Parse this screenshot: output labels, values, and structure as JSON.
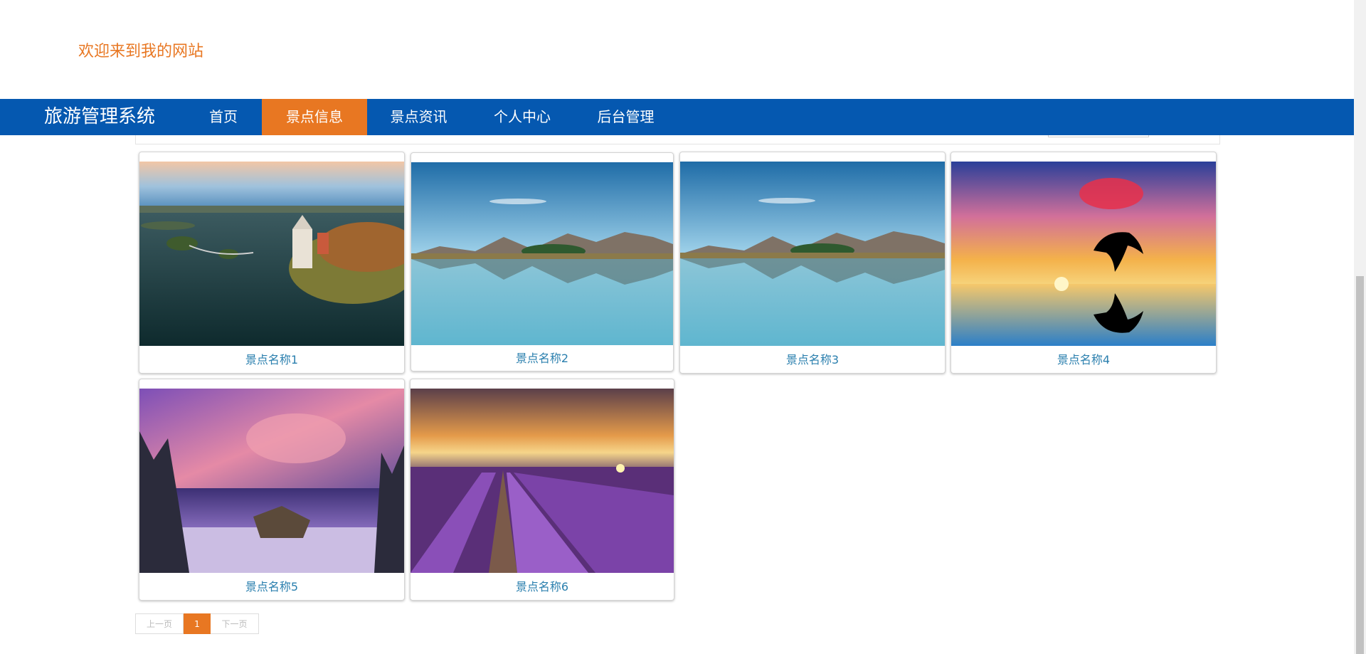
{
  "header": {
    "welcome_text": "欢迎来到我的网站"
  },
  "navbar": {
    "brand": "旅游管理系统",
    "items": [
      {
        "label": "首页",
        "active": false
      },
      {
        "label": "景点信息",
        "active": true
      },
      {
        "label": "景点资讯",
        "active": false
      },
      {
        "label": "个人中心",
        "active": false
      },
      {
        "label": "后台管理",
        "active": false
      }
    ]
  },
  "spots": [
    {
      "name": "景点名称1",
      "image": "castle-island-lake"
    },
    {
      "name": "景点名称2",
      "image": "mountain-lake-reflection"
    },
    {
      "name": "景点名称3",
      "image": "mountain-lake-reflection"
    },
    {
      "name": "景点名称4",
      "image": "dolphin-sunset"
    },
    {
      "name": "景点名称5",
      "image": "crater-lake-pink-sky"
    },
    {
      "name": "景点名称6",
      "image": "lavender-field-sunset"
    }
  ],
  "pagination": {
    "prev": "上一页",
    "current": "1",
    "next": "下一页"
  },
  "colors": {
    "nav_bg": "#0558b0",
    "accent": "#e87722",
    "link": "#2a7fae"
  }
}
